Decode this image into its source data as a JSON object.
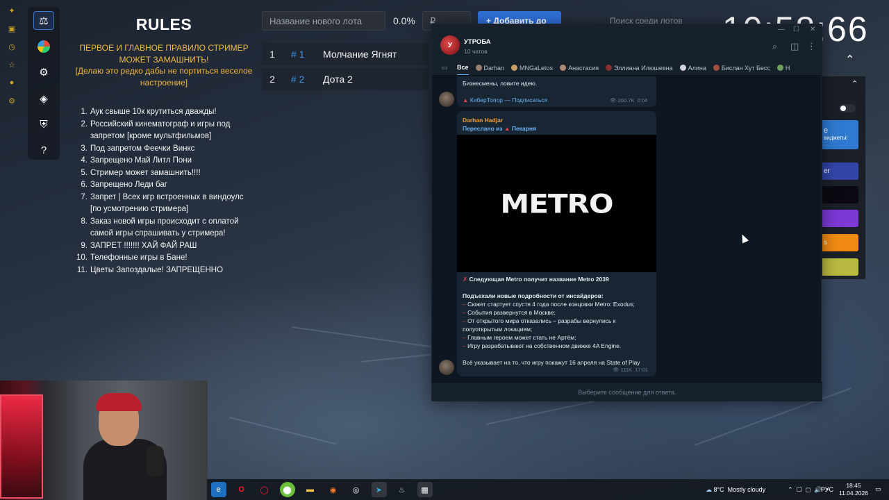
{
  "rules": {
    "title": "RULES",
    "main_rule": "ПЕРВОЕ И ГЛАВНОЕ ПРАВИЛО СТРИМЕР МОЖЕТ ЗАМАШНИТЬ!",
    "main_rule_note": "[Делаю это редко дабы не портиться веселое настроение]",
    "items": [
      {
        "n": "1.",
        "text": "Аук свыше 10к крутиться дважды!"
      },
      {
        "n": "2.",
        "text": "Российский кинематограф и игры  под запретом [кроме мультфильмов]"
      },
      {
        "n": "3.",
        "text": "Под запретом Феечки Винкс"
      },
      {
        "n": "4.",
        "text": "Запрещено Май Литл Пони"
      },
      {
        "n": "5.",
        "text": "Стример может замашнить!!!!"
      },
      {
        "n": "6.",
        "text": "Запрещено Леди баг"
      },
      {
        "n": "7.",
        "text": "Запрет | Всех игр встроенных в виндоулс [по усмотрению стримера]"
      },
      {
        "n": "8.",
        "text": "Заказ новой игры происходит с оплатой самой игры спрашивать у стримера!"
      },
      {
        "n": "9.",
        "text": "ЗАПРЕТ !!!!!!! ХАЙ ФАЙ РАШ"
      },
      {
        "n": "10.",
        "text": "Телефонные игры в Бане!"
      },
      {
        "n": "11.",
        "text": "Цветы Запоздалые! ЗАПРЕЩЕННО"
      }
    ]
  },
  "auction": {
    "lot_placeholder": "Название нового лота",
    "percent": "0.0%",
    "price_placeholder": "₽",
    "add_button": "+ Добавить до",
    "search_placeholder": "Поиск среди лотов",
    "timer": "10:58:66",
    "lots": [
      {
        "num": "1",
        "id": "# 1",
        "name": "Молчание Ягнят"
      },
      {
        "num": "2",
        "id": "# 2",
        "name": "Дота 2"
      }
    ]
  },
  "widgets": {
    "b1_title": "е",
    "b1_sub": "виджеты!",
    "b2": "er",
    "b5": "s",
    "colors": [
      "#2f7ad0",
      "#3345a8",
      "#0b0a12",
      "#7d39d6",
      "#f08a12",
      "#b9b942"
    ]
  },
  "telegram": {
    "chat_title": "УТРОБА",
    "chat_sub": "10 чатов",
    "tabs": [
      "Все",
      "Darhan",
      "MNGaLetos",
      "Анастасия",
      "Эллиана Илюшевна",
      "Алина",
      "Бислан Хут Бесс",
      "Н"
    ],
    "msg1_text": "Бизнесмены, ловите идею.",
    "msg1_link": "КиберТопор — Подписаться",
    "msg1_views": "260.7K",
    "msg1_time": "0:04",
    "msg2_author": "Darhan Hadjar",
    "msg2_fwd_prefix": "Переслано из",
    "msg2_fwd_source": "Пекарня",
    "msg2_image_text": "METRO",
    "msg2_headline": "Следующая Metro получит название Metro 2039",
    "msg2_intro": "Подъехали новые подробности от инсайдеров:",
    "msg2_points": [
      "Сюжет стартует спустя 4 года после концовки Metro: Exodus;",
      "События развернутся в Москве;",
      "От открытого мира отказались – разрабы вернулись к полуоткрытым локациям;",
      "Главным героем может стать не Артём;",
      "Игру разрабатывают на собственном движке 4A Engine."
    ],
    "msg2_outro": "Всё указывает на то, что игру покажут 16 апреля на State of Play",
    "msg2_views": "111K",
    "msg2_time": "17:01",
    "footer": "Выберите сообщение для ответа."
  },
  "taskbar": {
    "weather_temp": "8°C",
    "weather_text": "Mostly cloudy",
    "lang": "РУС",
    "time": "18:45",
    "date": "11.04.2026"
  }
}
